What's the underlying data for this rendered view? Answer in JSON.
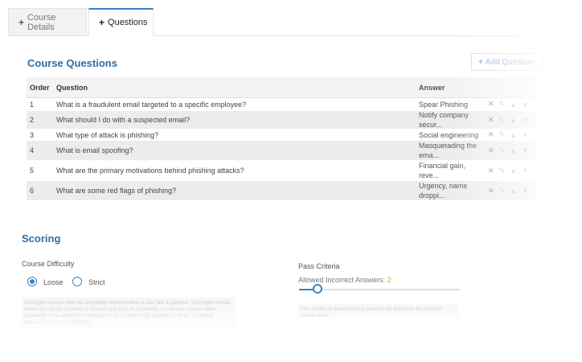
{
  "tabs": [
    {
      "label": "Course Details",
      "icon": "plus-icon"
    },
    {
      "label": "Questions",
      "icon": "plus-icon"
    }
  ],
  "course_questions": {
    "title": "Course Questions",
    "add_button": "Add Question",
    "headers": {
      "order": "Order",
      "question": "Question",
      "answer": "Answer"
    },
    "rows": [
      {
        "order": "1",
        "question": "What is a fraudulent email targeted to a specific employee?",
        "answer": "Spear Phishing"
      },
      {
        "order": "2",
        "question": "What should I do with a suspected email?",
        "answer": "Notify company secur..."
      },
      {
        "order": "3",
        "question": "What type of attack is phishing?",
        "answer": "Social engineering"
      },
      {
        "order": "4",
        "question": "What is email spoofing?",
        "answer": "Masquerading the ema..."
      },
      {
        "order": "5",
        "question": "What are the primary motivations behind phishing attacks?",
        "answer": "Financial gain, reve..."
      },
      {
        "order": "6",
        "question": "What are some red flags of phishing?",
        "answer": "Urgency, name droppi..."
      }
    ],
    "row_actions": [
      "delete-icon",
      "edit-icon",
      "move-up-icon",
      "move-down-icon"
    ]
  },
  "scoring": {
    "title": "Scoring",
    "difficulty_label": "Course Difficulty",
    "options": [
      {
        "label": "Loose",
        "selected": true
      },
      {
        "label": "Strict",
        "selected": false
      }
    ],
    "difficulty_help": "Strict type courses must be completely restarted when a user fails a question. Strict type courses videos can not be scrubbed or skipped and must be completed. Loose type courses allow passability to be achieved by tolling but they can make skip questions and are a practical approach to the accomplishing.",
    "pass_label": "Pass Criteria",
    "allowed_label": "Allowed Incorrect Answers:",
    "allowed_value": "2",
    "slider_fraction": 0.12,
    "pass_help": "The number of allowed wrong answers will determine the pass/fail course result."
  },
  "colors": {
    "accent": "#3b82c4",
    "delete": "#d9534f",
    "edit": "#e2c04a",
    "value": "#e09a2b"
  }
}
